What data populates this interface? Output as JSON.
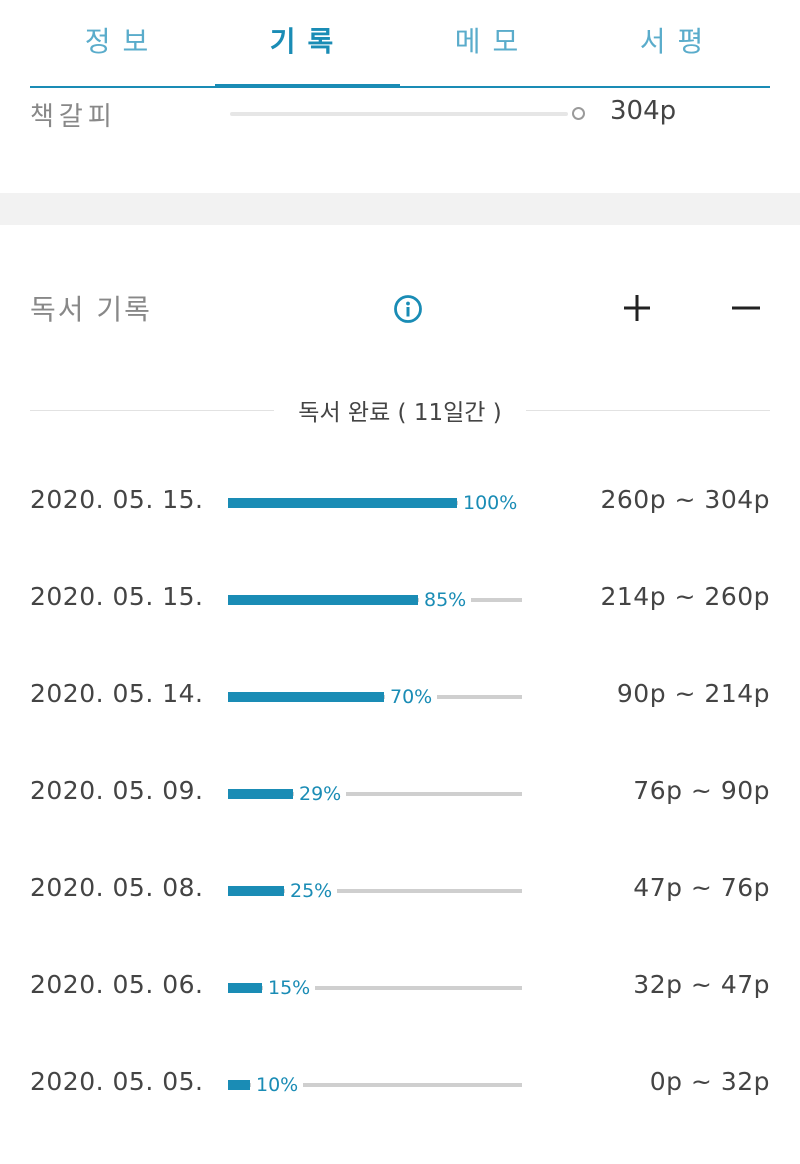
{
  "tabs": [
    {
      "label": "정보",
      "active": false
    },
    {
      "label": "기록",
      "active": true
    },
    {
      "label": "메모",
      "active": false
    },
    {
      "label": "서평",
      "active": false
    }
  ],
  "bookmark": {
    "label": "책갈피",
    "page": "304p"
  },
  "section": {
    "title": "독서 기록",
    "info_icon": "info-icon",
    "add_icon": "plus-icon",
    "remove_icon": "minus-icon"
  },
  "summary": {
    "text": "독서 완료 ( 11일간 )"
  },
  "colors": {
    "accent": "#1a8cb5",
    "track": "#cfcfcf",
    "text": "#444444",
    "muted": "#888888"
  },
  "logs": [
    {
      "date": "2020. 05. 15.",
      "percent": 100,
      "percent_label": "100%",
      "range": "260p ~ 304p"
    },
    {
      "date": "2020. 05. 15.",
      "percent": 85,
      "percent_label": "85%",
      "range": "214p ~ 260p"
    },
    {
      "date": "2020. 05. 14.",
      "percent": 70,
      "percent_label": "70%",
      "range": "90p ~ 214p"
    },
    {
      "date": "2020. 05. 09.",
      "percent": 29,
      "percent_label": "29%",
      "range": "76p ~ 90p"
    },
    {
      "date": "2020. 05. 08.",
      "percent": 25,
      "percent_label": "25%",
      "range": "47p ~ 76p"
    },
    {
      "date": "2020. 05. 06.",
      "percent": 15,
      "percent_label": "15%",
      "range": "32p ~ 47p"
    },
    {
      "date": "2020. 05. 05.",
      "percent": 10,
      "percent_label": "10%",
      "range": "0p ~ 32p"
    }
  ]
}
